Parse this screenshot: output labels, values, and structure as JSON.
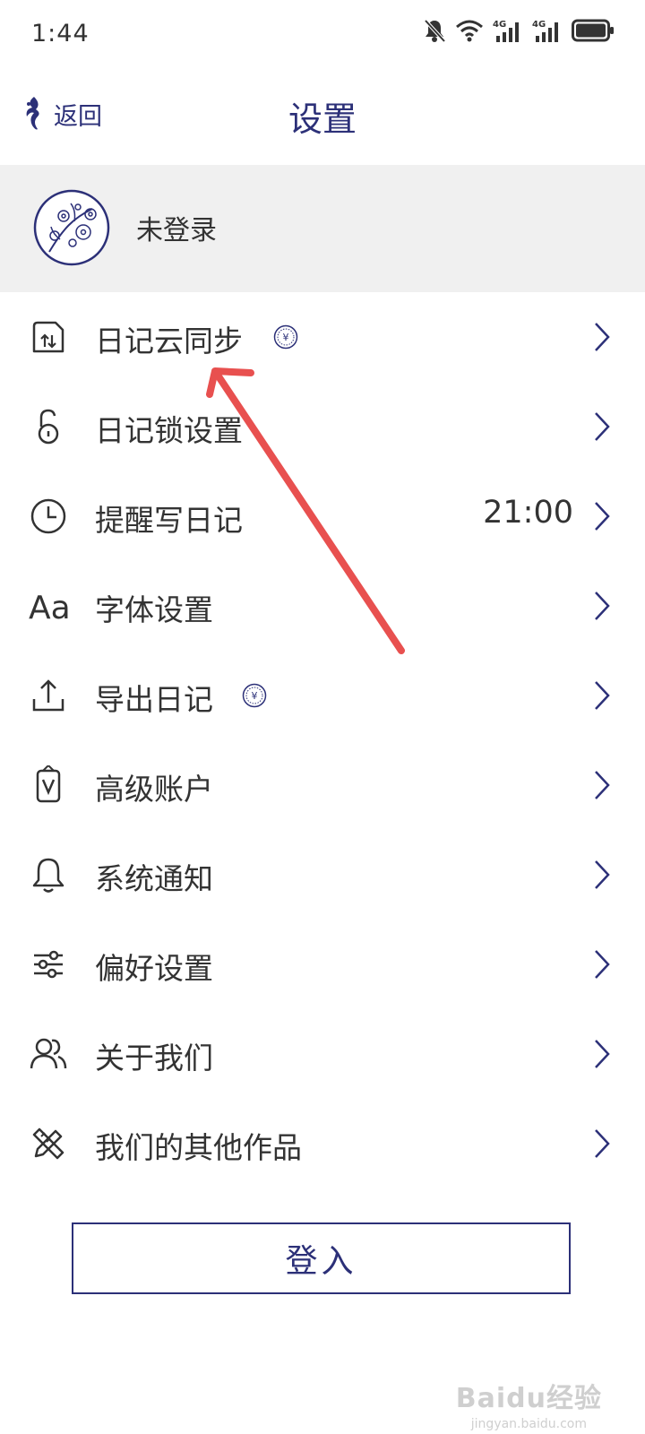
{
  "status_bar": {
    "time": "1:44",
    "icons": [
      "mute-bell-icon",
      "wifi-icon",
      "signal-4g-icon",
      "signal-4g-icon",
      "battery-icon"
    ],
    "network_labels": [
      "4G",
      "4G"
    ]
  },
  "nav": {
    "back_label": "返回",
    "title": "设置"
  },
  "profile": {
    "name": "未登录"
  },
  "menu": {
    "items": [
      {
        "label": "日记云同步",
        "icon": "cloud-sync-icon",
        "premium": true,
        "value": ""
      },
      {
        "label": "日记锁设置",
        "icon": "lock-icon",
        "premium": false,
        "value": ""
      },
      {
        "label": "提醒写日记",
        "icon": "clock-icon",
        "premium": false,
        "value": "21:00"
      },
      {
        "label": "字体设置",
        "icon": "font-icon",
        "premium": false,
        "value": ""
      },
      {
        "label": "导出日记",
        "icon": "export-icon",
        "premium": true,
        "value": ""
      },
      {
        "label": "高级账户",
        "icon": "premium-account-icon",
        "premium": false,
        "value": ""
      },
      {
        "label": "系统通知",
        "icon": "bell-icon",
        "premium": false,
        "value": ""
      },
      {
        "label": "偏好设置",
        "icon": "sliders-icon",
        "premium": false,
        "value": ""
      },
      {
        "label": "关于我们",
        "icon": "people-icon",
        "premium": false,
        "value": ""
      },
      {
        "label": "我们的其他作品",
        "icon": "design-tools-icon",
        "premium": false,
        "value": ""
      }
    ],
    "premium_badge": "¥"
  },
  "login_button": {
    "label": "登入"
  },
  "watermark": {
    "main": "Baidu经验",
    "sub": "jingyan.baidu.com"
  },
  "colors": {
    "accent": "#2c3078",
    "text": "#333333",
    "profile_bg": "#f0f0f0",
    "annotation": "#e8504f"
  }
}
